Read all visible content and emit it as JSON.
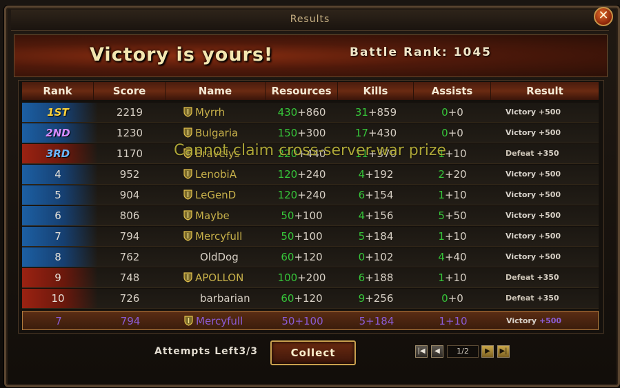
{
  "window": {
    "title": "Results",
    "close_symbol": "✕"
  },
  "banner": {
    "headline": "Victory is yours!",
    "battle_rank_label": "Battle Rank:",
    "battle_rank_value": "1045"
  },
  "table": {
    "headers": [
      "Rank",
      "Score",
      "Name",
      "Resources",
      "Kills",
      "Assists",
      "Result"
    ],
    "rows": [
      {
        "rank": "1ST",
        "score": "2219",
        "name": "Myrrh",
        "guild": true,
        "res_a": "430",
        "res_b": "+860",
        "kills_a": "31",
        "kills_b": "+859",
        "assists_a": "0",
        "assists_b": "+0",
        "result": "Victory",
        "result_pts": "+500",
        "side": "win"
      },
      {
        "rank": "2ND",
        "score": "1230",
        "name": "Bulgaria",
        "guild": true,
        "res_a": "150",
        "res_b": "+300",
        "kills_a": "17",
        "kills_b": "+430",
        "assists_a": "0",
        "assists_b": "+0",
        "result": "Victory",
        "result_pts": "+500",
        "side": "win"
      },
      {
        "rank": "3RD",
        "score": "1170",
        "name": "Bravelys",
        "guild": true,
        "res_a": "220",
        "res_b": "+440",
        "kills_a": "11",
        "kills_b": "+370",
        "assists_a": "1",
        "assists_b": "+10",
        "result": "Defeat",
        "result_pts": "+350",
        "side": "lose"
      },
      {
        "rank": "4",
        "score": "952",
        "name": "LenobiA",
        "guild": true,
        "res_a": "120",
        "res_b": "+240",
        "kills_a": "4",
        "kills_b": "+192",
        "assists_a": "2",
        "assists_b": "+20",
        "result": "Victory",
        "result_pts": "+500",
        "side": "win"
      },
      {
        "rank": "5",
        "score": "904",
        "name": "LeGenD",
        "guild": true,
        "res_a": "120",
        "res_b": "+240",
        "kills_a": "6",
        "kills_b": "+154",
        "assists_a": "1",
        "assists_b": "+10",
        "result": "Victory",
        "result_pts": "+500",
        "side": "win"
      },
      {
        "rank": "6",
        "score": "806",
        "name": "Maybe",
        "guild": true,
        "res_a": "50",
        "res_b": "+100",
        "kills_a": "4",
        "kills_b": "+156",
        "assists_a": "5",
        "assists_b": "+50",
        "result": "Victory",
        "result_pts": "+500",
        "side": "win"
      },
      {
        "rank": "7",
        "score": "794",
        "name": "Mercyfull",
        "guild": true,
        "res_a": "50",
        "res_b": "+100",
        "kills_a": "5",
        "kills_b": "+184",
        "assists_a": "1",
        "assists_b": "+10",
        "result": "Victory",
        "result_pts": "+500",
        "side": "win"
      },
      {
        "rank": "8",
        "score": "762",
        "name": "OldDog",
        "guild": false,
        "res_a": "60",
        "res_b": "+120",
        "kills_a": "0",
        "kills_b": "+102",
        "assists_a": "4",
        "assists_b": "+40",
        "result": "Victory",
        "result_pts": "+500",
        "side": "win"
      },
      {
        "rank": "9",
        "score": "748",
        "name": "APOLLON",
        "guild": true,
        "res_a": "100",
        "res_b": "+200",
        "kills_a": "6",
        "kills_b": "+188",
        "assists_a": "1",
        "assists_b": "+10",
        "result": "Defeat",
        "result_pts": "+350",
        "side": "lose"
      },
      {
        "rank": "10",
        "score": "726",
        "name": "barbarian",
        "guild": false,
        "res_a": "60",
        "res_b": "+120",
        "kills_a": "9",
        "kills_b": "+256",
        "assists_a": "0",
        "assists_b": "+0",
        "result": "Defeat",
        "result_pts": "+350",
        "side": "lose"
      }
    ],
    "my_row": {
      "rank": "7",
      "score": "794",
      "name": "Mercyfull",
      "guild": true,
      "res_a": "50",
      "res_b": "+100",
      "kills_a": "5",
      "kills_b": "+184",
      "assists_a": "1",
      "assists_b": "+10",
      "result": "Victory",
      "result_pts": "+500"
    }
  },
  "overlay_message": "Cannot claim cross-server-war prize",
  "footer": {
    "attempts_label": "Attempts Left",
    "attempts_value": "3/3",
    "collect_label": "Collect",
    "page": "1/2"
  },
  "colors": {
    "accent_gold": "#c9a04e",
    "win_blue": "#1c5fa3",
    "lose_red": "#9b2212",
    "highlight_purple": "#8a5cd6"
  }
}
